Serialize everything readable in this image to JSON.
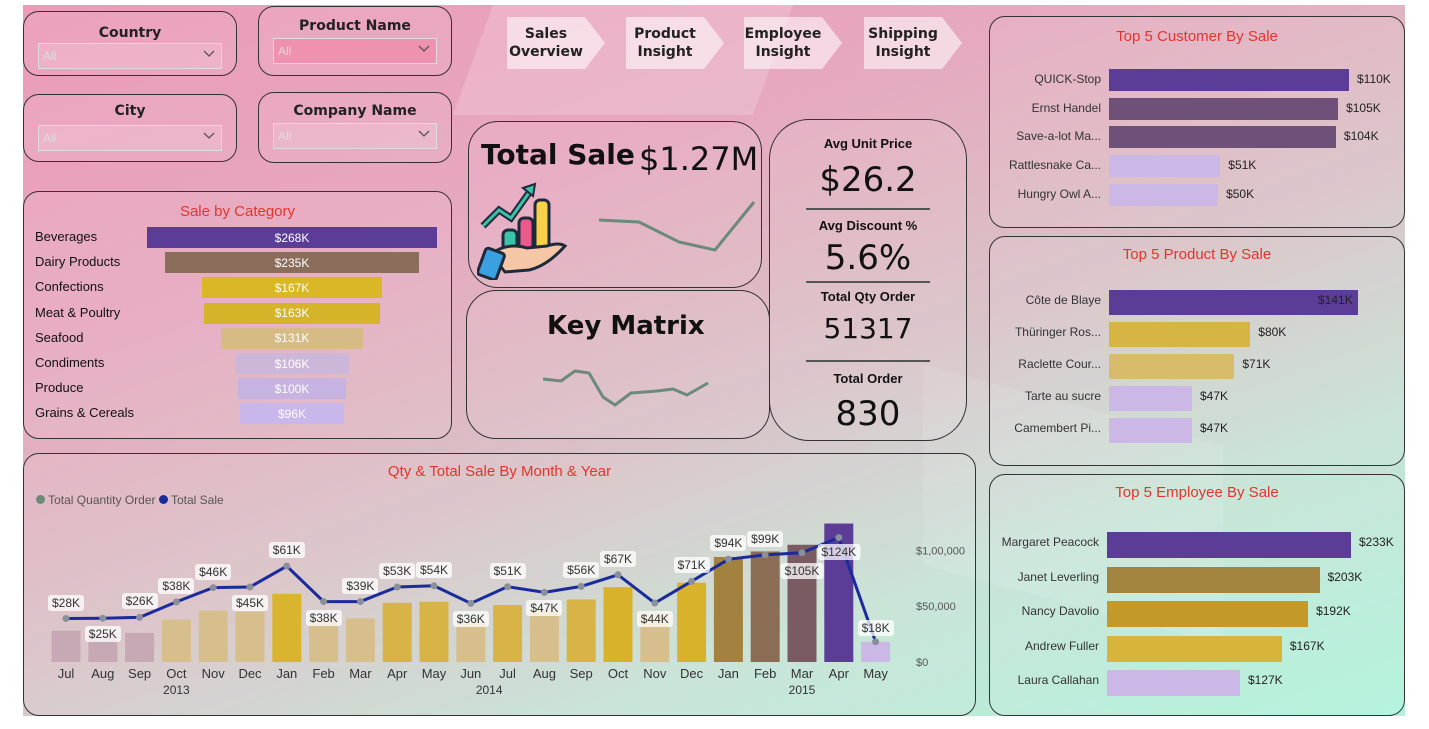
{
  "slicers": {
    "country": {
      "label": "Country",
      "value": "All"
    },
    "product": {
      "label": "Product Name",
      "value": "All"
    },
    "city": {
      "label": "City",
      "value": "All"
    },
    "company": {
      "label": "Company Name",
      "value": "All"
    }
  },
  "nav": [
    {
      "line1": "Sales",
      "line2": "Overview"
    },
    {
      "line1": "Product",
      "line2": "Insight"
    },
    {
      "line1": "Employee",
      "line2": "Insight"
    },
    {
      "line1": "Shipping",
      "line2": "Insight"
    }
  ],
  "total_sale": {
    "title": "Total Sale",
    "value": "$1.27M"
  },
  "key_matrix": {
    "title": "Key Matrix"
  },
  "kpis": {
    "avg_unit_price": {
      "title": "Avg Unit Price",
      "value": "$26.2"
    },
    "avg_discount": {
      "title": "Avg Discount %",
      "value": "5.6%"
    },
    "total_qty": {
      "title": "Total Qty Order",
      "value": "51317"
    },
    "total_order": {
      "title": "Total Order",
      "value": "830"
    }
  },
  "category": {
    "title": "Sale by Category",
    "items": [
      {
        "name": "Beverages",
        "label": "$268K",
        "value": 268,
        "color": "#5b3d97"
      },
      {
        "name": "Dairy Products",
        "label": "$235K",
        "value": 235,
        "color": "#8b6d5c"
      },
      {
        "name": "Confections",
        "label": "$167K",
        "value": 167,
        "color": "#d9b726"
      },
      {
        "name": "Meat & Poultry",
        "label": "$163K",
        "value": 163,
        "color": "#d6b429"
      },
      {
        "name": "Seafood",
        "label": "$131K",
        "value": 131,
        "color": "#d7bb86"
      },
      {
        "name": "Condiments",
        "label": "$106K",
        "value": 106,
        "color": "#cdb7d8"
      },
      {
        "name": "Produce",
        "label": "$100K",
        "value": 100,
        "color": "#c7b3e2"
      },
      {
        "name": "Grains & Cereals",
        "label": "$96K",
        "value": 96,
        "color": "#c9b6ea"
      }
    ]
  },
  "top_customers": {
    "title": "Top 5 Customer By Sale",
    "items": [
      {
        "name": "QUICK-Stop",
        "label": "$110K",
        "value": 110,
        "color": "#5b3d97"
      },
      {
        "name": "Ernst Handel",
        "label": "$105K",
        "value": 105,
        "color": "#6f5078"
      },
      {
        "name": "Save-a-lot Ma...",
        "label": "$104K",
        "value": 104,
        "color": "#6f5078"
      },
      {
        "name": "Rattlesnake Ca...",
        "label": "$51K",
        "value": 51,
        "color": "#cbb8e6"
      },
      {
        "name": "Hungry Owl A...",
        "label": "$50K",
        "value": 50,
        "color": "#cbb8e6"
      }
    ]
  },
  "top_products": {
    "title": "Top 5 Product By Sale",
    "items": [
      {
        "name": "Côte de Blaye",
        "label": "$141K",
        "value": 141,
        "color": "#5b3d97"
      },
      {
        "name": "Thüringer Ros...",
        "label": "$80K",
        "value": 80,
        "color": "#d6b545"
      },
      {
        "name": "Raclette Cour...",
        "label": "$71K",
        "value": 71,
        "color": "#d9bb6c"
      },
      {
        "name": "Tarte au sucre",
        "label": "$47K",
        "value": 47,
        "color": "#cbb8e6"
      },
      {
        "name": "Camembert Pi...",
        "label": "$47K",
        "value": 47,
        "color": "#cbb8e6"
      }
    ]
  },
  "top_employees": {
    "title": "Top 5 Employee By Sale",
    "items": [
      {
        "name": "Margaret Peacock",
        "label": "$233K",
        "value": 233,
        "color": "#5b3d97"
      },
      {
        "name": "Janet Leverling",
        "label": "$203K",
        "value": 203,
        "color": "#a3853f"
      },
      {
        "name": "Nancy Davolio",
        "label": "$192K",
        "value": 192,
        "color": "#c3992a"
      },
      {
        "name": "Andrew Fuller",
        "label": "$167K",
        "value": 167,
        "color": "#d7b53a"
      },
      {
        "name": "Laura Callahan",
        "label": "$127K",
        "value": 127,
        "color": "#cbb8e6"
      }
    ]
  },
  "chart_data": {
    "type": "bar",
    "title": "Qty & Total Sale By Month & Year",
    "legend": [
      "Total Quantity Order",
      "Total Sale"
    ],
    "legend_colors": [
      "#6b8a7a",
      "#1b2b9c"
    ],
    "y_ticks": [
      "$1,00,000",
      "$50,000",
      "$0"
    ],
    "ylim": [
      0,
      120000
    ],
    "months": [
      "Jul",
      "Aug",
      "Sep",
      "Oct",
      "Nov",
      "Dec",
      "Jan",
      "Feb",
      "Mar",
      "Apr",
      "May",
      "Jun",
      "Jul",
      "Aug",
      "Sep",
      "Oct",
      "Nov",
      "Dec",
      "Jan",
      "Feb",
      "Mar",
      "Apr",
      "May"
    ],
    "years": [
      {
        "label": "2013",
        "center_index": 3
      },
      {
        "label": "2014",
        "center_index": 11.5
      },
      {
        "label": "2015",
        "center_index": 20
      }
    ],
    "sales": [
      28,
      25,
      26,
      38,
      46,
      45,
      61,
      38,
      39,
      53,
      54,
      36,
      51,
      47,
      56,
      67,
      44,
      71,
      94,
      99,
      105,
      124,
      18
    ],
    "sale_labels": [
      "$28K",
      "$25K",
      "$26K",
      "$38K",
      "$46K",
      "$45K",
      "$61K",
      "$38K",
      "$39K",
      "$53K",
      "$54K",
      "$36K",
      "$51K",
      "$47K",
      "$56K",
      "$67K",
      "$44K",
      "$71K",
      "$94K",
      "$99K",
      "$105K",
      "$124K",
      "$18K"
    ],
    "qty": [
      1460,
      1470,
      1500,
      2020,
      2500,
      2520,
      3220,
      2030,
      2030,
      2520,
      2560,
      1970,
      2530,
      2340,
      2540,
      2930,
      1980,
      2710,
      3450,
      3600,
      3670,
      4180,
      680
    ],
    "bar_colors": [
      "#c7a9b6",
      "#c7a9b6",
      "#c7a9b6",
      "#d6be8d",
      "#d6be8d",
      "#d6be8d",
      "#d9b52f",
      "#d6be8d",
      "#d6be8d",
      "#d7b445",
      "#d7b445",
      "#d6be8d",
      "#d7b445",
      "#d6be8d",
      "#d7b445",
      "#d8b22a",
      "#d6be8d",
      "#d8b22a",
      "#a3823f",
      "#8b6c55",
      "#7b5b62",
      "#5b3d97",
      "#cbb8e6"
    ]
  }
}
